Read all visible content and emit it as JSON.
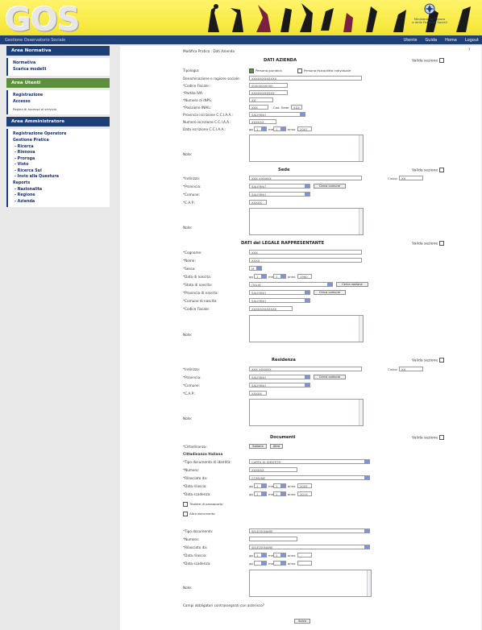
{
  "header": {
    "logo": "GOS",
    "subtitle": "Gestione Osservatorio Sociale",
    "gov_line1": "Ministero del Lavoro",
    "gov_line2": "e delle Politiche Sociali",
    "nav": [
      "Utente",
      "Guida",
      "Home",
      "Logout"
    ]
  },
  "sidebar": {
    "sections": [
      {
        "title": "Area Normativa",
        "items": [
          "Normativa",
          "Scarica modelli"
        ]
      },
      {
        "title": "Area Utenti",
        "items": [
          "Registrazione",
          "Accesso"
        ],
        "note": "Pagina di accesso al servizio"
      },
      {
        "title": "Area Amministratore",
        "items": [
          "Registrazione Operatore",
          "Gestione Pratica"
        ],
        "subitems": [
          "Ricerca",
          "Rinnova",
          "Proroga",
          "Visto",
          "Ricerca Sul",
          "Invio alla Questura"
        ],
        "reports": "Reports",
        "report_items": [
          "Nazionalita",
          "Regione",
          "Azienda"
        ]
      }
    ]
  },
  "content": {
    "breadcrumb": "Modifica Pratica : Dati Azienda",
    "help": "?",
    "valida": "Valida sezione",
    "azienda": {
      "title": "DATI AZIENDA",
      "labels": [
        "Tipologia:",
        "Denominazione o ragione sociale:",
        "*Codice Fiscale:",
        "*Partita IVA:",
        "*Numero di INPS:",
        "*Posizione INAIL:",
        "Provincia iscrizione C.C.I.A.A.:",
        "Numero iscrizione C.C.I.A.A.:",
        "Data iscrizione C.C.I.A.A.:",
        "Note:"
      ],
      "tipologia_opts": [
        "Persona giuridica",
        "Persona fisica/ditta individuale"
      ],
      "values": [
        "XXXXXXXXXXXX",
        "00000000000",
        "XXXXXXXXXXX",
        "XX",
        "XXX",
        "SALERNO",
        "XXXXXX"
      ],
      "inail_label": "Cod. Sede",
      "inail_val": "XXX",
      "date": {
        "gg": "1",
        "mm": "1",
        "anno": "2007",
        "gg_label": "gg",
        "mm_label": "mm",
        "anno_label": "anno"
      }
    },
    "sede": {
      "title": "Sede",
      "labels": [
        "*Indirizzo:",
        "*Provincia:",
        "*Comune:",
        "*C.A.P.:",
        "Note:"
      ],
      "values": [
        "XXX XXXXXX",
        "SALERNO",
        "SALERNO",
        "XXXXX"
      ],
      "civico": "Civico:",
      "civico_val": "XX",
      "btn": "Cerca comune"
    },
    "legale": {
      "title": "DATI del LEGALE RAPPRESENTANTE",
      "labels": [
        "*Cognome:",
        "*Nome:",
        "*Sesso:",
        "*Data di nascita:",
        "*Stato di nascita:",
        "*Provincia di nascita:",
        "*Comune di nascita:",
        "*Codice Fiscale:",
        "Note:"
      ],
      "values": [
        "XXX",
        "XXXX",
        "M",
        "ITALIA",
        "SALERNO",
        "SALERNO",
        "XXXXXXXXXXXX"
      ],
      "date": {
        "gg": "1",
        "mm": "1",
        "anno": "1960"
      },
      "btn_stato": "Cerca nazione",
      "btn_comune": "Cerca comune"
    },
    "residenza": {
      "title": "Residenza",
      "labels": [
        "*Indirizzo:",
        "*Provincia:",
        "*Comune:",
        "*C.A.P.:",
        "Note:"
      ],
      "values": [
        "XXX XXXXXX",
        "SALERNO",
        "SALERNO",
        "XXXXX"
      ],
      "civico": "Civico:",
      "civico_val": "XX",
      "btn": "Cerca comune"
    },
    "documenti": {
      "title": "Documenti",
      "cittadinanza_label": "*Cittadinanza:",
      "btns": [
        "Italiana",
        "Altra"
      ],
      "sub": "Cittadinanza Italiana",
      "labels": [
        "*Tipo documento di identità:",
        "*Numero:",
        "*Rilasciato da:",
        "*Data rilascio:",
        "*Data scadenza:"
      ],
      "values": [
        "CARTA DI IDENTITA'",
        "XXXXXX",
        "COMUNE"
      ],
      "rilascio": {
        "gg": "1",
        "mm": "1",
        "anno": "2005"
      },
      "scadenza": {
        "gg": "1",
        "mm": "1",
        "anno": "2015"
      },
      "checks": [
        "Titolare di passaporto",
        "Altro documento"
      ],
      "labels2": [
        "*Tipo documento:",
        "*Numero:",
        "*Rilasciato da:",
        "*Data rilascio:",
        "*Data scadenza:",
        "Note:"
      ],
      "select": "SELEZIONARE"
    },
    "footer_q": "Campi obbligatori contrassegnati con asterisco?",
    "submit": "Salva"
  }
}
